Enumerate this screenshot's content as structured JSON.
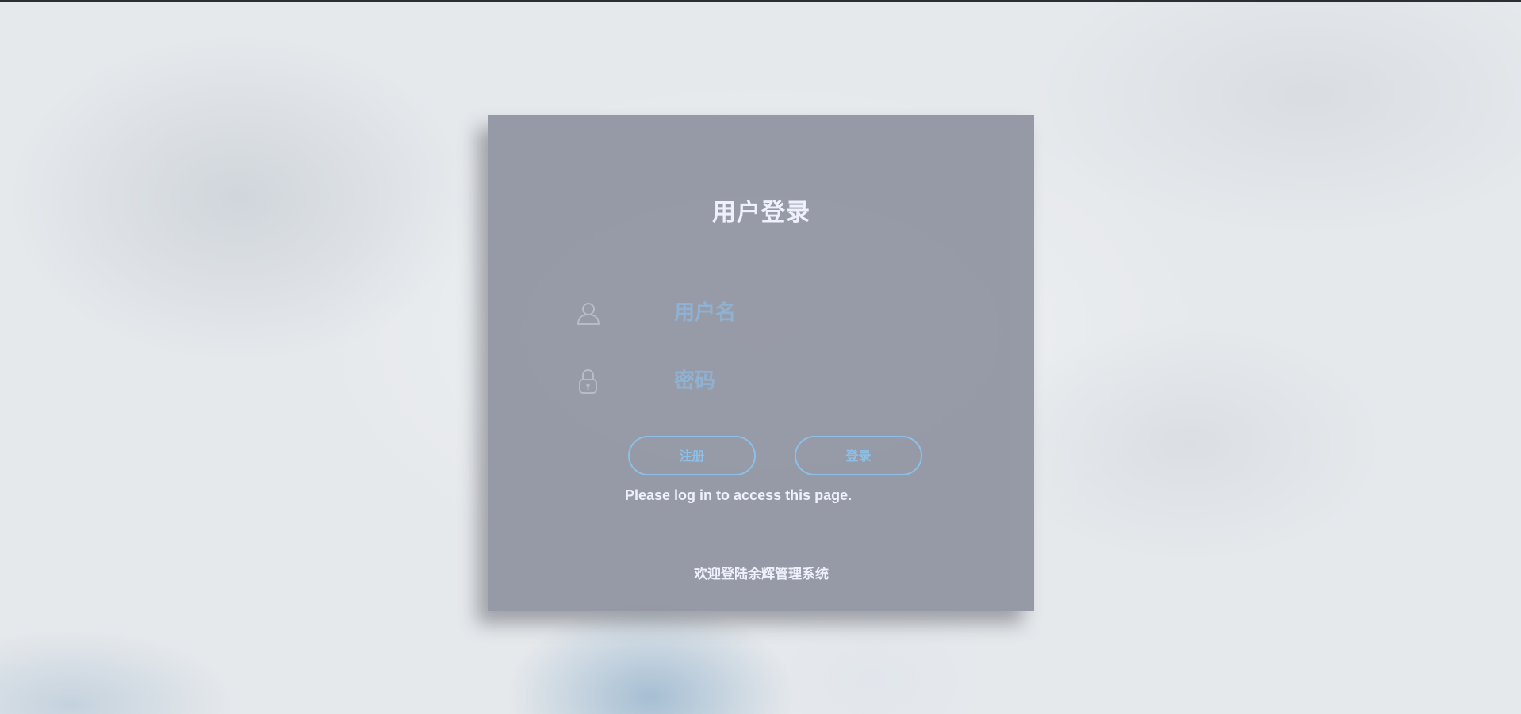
{
  "login": {
    "title": "用户登录",
    "username": {
      "placeholder": "用户名",
      "icon": "user-icon"
    },
    "password": {
      "placeholder": "密码",
      "icon": "lock-icon"
    },
    "register_label": "注册",
    "login_label": "登录",
    "message": "Please log in to access this page.",
    "footer": "欢迎登陆余辉管理系统"
  },
  "colors": {
    "accent": "#8cc0e6",
    "placeholder": "#8fb2d2",
    "panel": "#848896",
    "text": "#eef0fb"
  }
}
